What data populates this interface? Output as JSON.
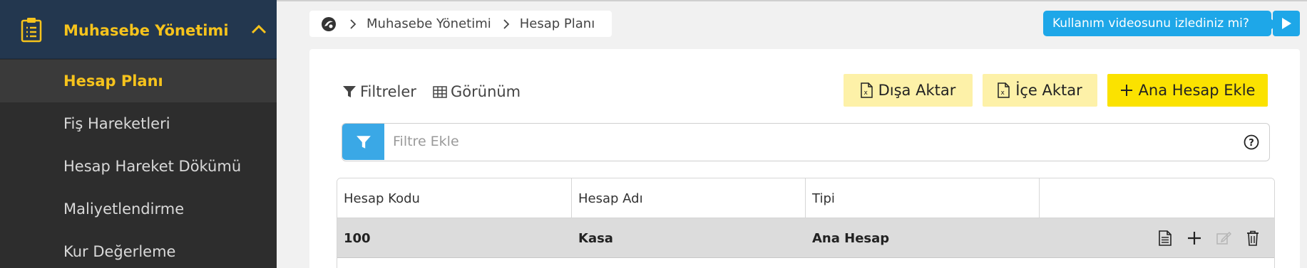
{
  "sidebar": {
    "section_title": "Muhasebe Yönetimi",
    "section_icon": "clipboard-icon",
    "collapse_icon": "chevron-up-icon",
    "items": [
      {
        "label": "Hesap Planı",
        "active": true
      },
      {
        "label": "Fiş Hareketleri",
        "active": false
      },
      {
        "label": "Hesap Hareket Dökümü",
        "active": false
      },
      {
        "label": "Maliyetlendirme",
        "active": false
      },
      {
        "label": "Kur Değerleme",
        "active": false
      }
    ]
  },
  "breadcrumb": {
    "home_icon": "brand-logo-icon",
    "items": [
      "Muhasebe Yönetimi",
      "Hesap Planı"
    ]
  },
  "video_help": {
    "text": "Kullanım videosunu izlediniz mi?",
    "icon": "play-icon"
  },
  "toolbar": {
    "filters_label": "Filtreler",
    "view_label": "Görünüm",
    "export_label": "Dışa Aktar",
    "import_label": "İçe Aktar",
    "add_label": "Ana Hesap Ekle"
  },
  "filter_bar": {
    "placeholder": "Filtre Ekle",
    "value": ""
  },
  "table": {
    "columns": [
      "Hesap Kodu",
      "Hesap Adı",
      "Tipi",
      ""
    ],
    "rows": [
      {
        "code": "100",
        "name": "Kasa",
        "type": "Ana Hesap"
      }
    ]
  },
  "colors": {
    "sidebar_bg": "#2d2d2d",
    "sidebar_header_bg": "#23374f",
    "accent_yellow": "#f6c31c",
    "primary_button": "#fbe200",
    "light_button": "#fdf1a8",
    "info_blue": "#1ea7e8"
  }
}
